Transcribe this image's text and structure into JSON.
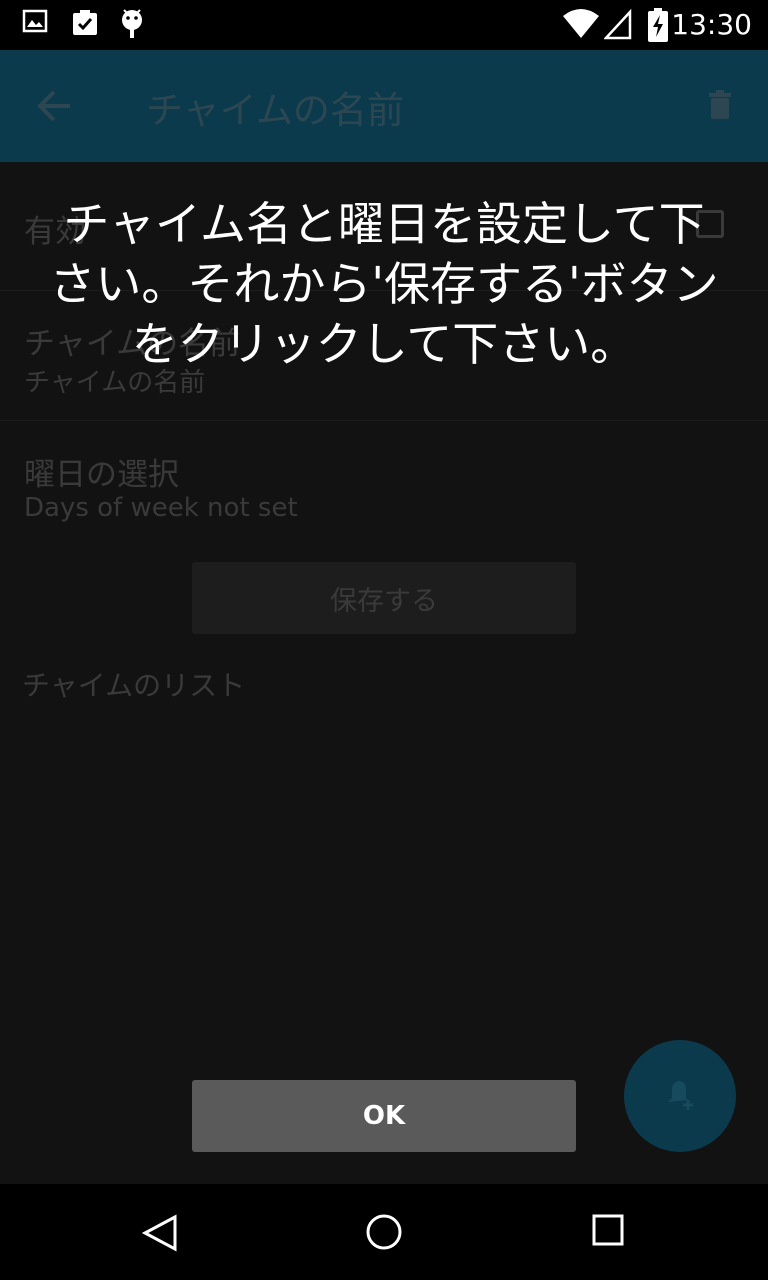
{
  "status_bar": {
    "time": "13:30",
    "icons": [
      "image-icon",
      "clipboard-check-icon",
      "android-icon",
      "wifi-icon",
      "signal-icon",
      "battery-charging-icon"
    ]
  },
  "app_bar": {
    "title": "チャイムの名前",
    "back_icon": "arrow-back-icon",
    "delete_icon": "trash-icon"
  },
  "form": {
    "enabled_label": "有効",
    "name_label": "チャイムの名前",
    "name_value": "チャイムの名前",
    "dow_label": "曜日の選択",
    "dow_value": "Days of week not set",
    "save_label": "保存する",
    "list_label": "チャイムのリスト"
  },
  "overlay": {
    "message_line1": "チャイム名と曜日を設定して下",
    "message_line2": "さい。それから'保存する'ボタン",
    "message_line3": "をクリックして下さい。",
    "ok_label": "OK"
  },
  "fab": {
    "icon": "add-alarm-bell-icon"
  },
  "nav_bar": {
    "icons": [
      "back-triangle-icon",
      "home-circle-icon",
      "recents-square-icon"
    ]
  },
  "colors": {
    "app_bar": "#0b3a4d",
    "content_bg": "#121212",
    "ok_button": "#5a5a5a"
  }
}
